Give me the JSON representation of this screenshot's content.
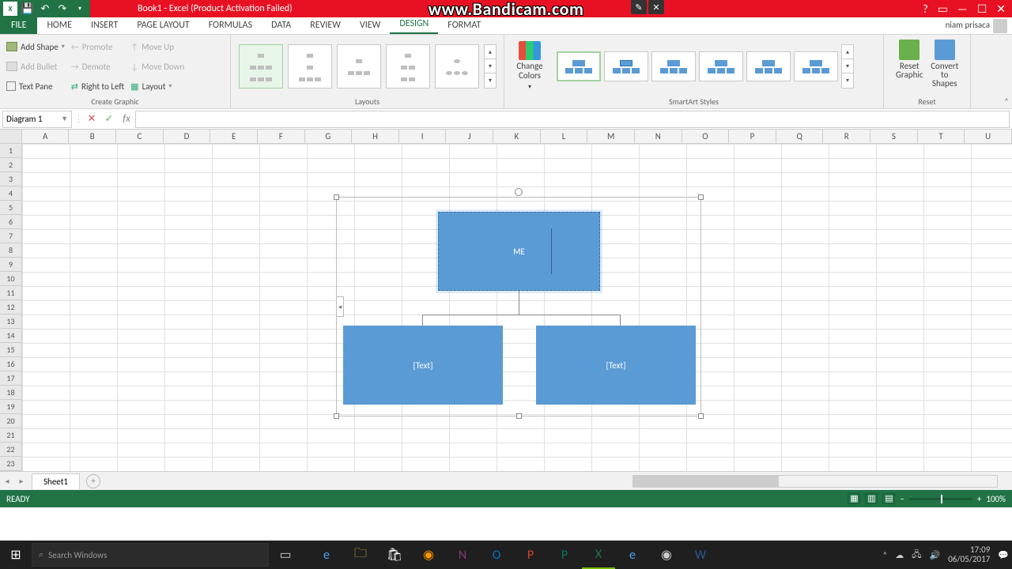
{
  "topbar": {
    "title": "Book1 - Excel (Product Activation Failed)",
    "watermark": "www.Bandicam.com"
  },
  "tabs": {
    "file": "FILE",
    "home": "HOME",
    "insert": "INSERT",
    "pageLayout": "PAGE LAYOUT",
    "formulas": "FORMULAS",
    "data": "DATA",
    "review": "REVIEW",
    "view": "VIEW",
    "design": "DESIGN",
    "format": "FORMAT",
    "user": "niam prisaca"
  },
  "ribbon": {
    "createGraphic": {
      "addShape": "Add Shape",
      "addBullet": "Add Bullet",
      "textPane": "Text Pane",
      "promote": "Promote",
      "demote": "Demote",
      "rtl": "Right to Left",
      "moveUp": "Move Up",
      "moveDown": "Move Down",
      "layout": "Layout",
      "groupLabel": "Create Graphic"
    },
    "layouts": {
      "groupLabel": "Layouts"
    },
    "styles": {
      "changeColors": "Change Colors",
      "groupLabel": "SmartArt Styles"
    },
    "reset": {
      "resetGraphic": "Reset Graphic",
      "convert": "Convert to Shapes",
      "groupLabel": "Reset"
    }
  },
  "formulaBar": {
    "nameBox": "Diagram 1",
    "fx": "fx"
  },
  "columns": [
    "A",
    "B",
    "C",
    "D",
    "E",
    "F",
    "G",
    "H",
    "I",
    "J",
    "K",
    "L",
    "M",
    "N",
    "O",
    "P",
    "Q",
    "R",
    "S",
    "T",
    "U"
  ],
  "rowCount": 24,
  "smartart": {
    "top": "ME",
    "left": "[Text]",
    "right": "[Text]"
  },
  "sheetTabs": {
    "sheet1": "Sheet1"
  },
  "statusbar": {
    "ready": "READY",
    "zoom": "100%"
  },
  "taskbar": {
    "search": "Search Windows",
    "time": "17:09",
    "date": "06/05/2017"
  }
}
